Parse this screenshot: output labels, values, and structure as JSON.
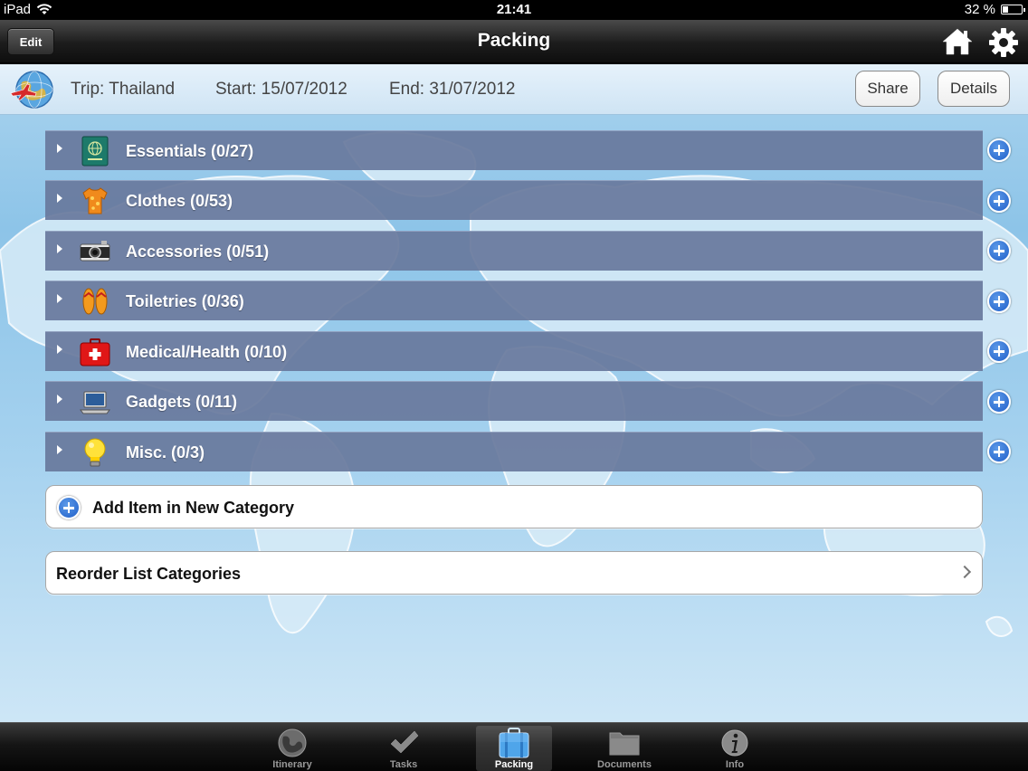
{
  "status_bar": {
    "device": "iPad",
    "time": "21:41",
    "battery": "32 %",
    "battery_level": 0.32
  },
  "nav": {
    "edit_label": "Edit",
    "title": "Packing"
  },
  "trip": {
    "trip_label": "Trip: Thailand",
    "start_label": "Start: 15/07/2012",
    "end_label": "End: 31/07/2012",
    "share_label": "Share",
    "details_label": "Details"
  },
  "categories": [
    {
      "label": "Essentials (0/27)",
      "icon": "passport-icon"
    },
    {
      "label": "Clothes (0/53)",
      "icon": "shirt-icon"
    },
    {
      "label": "Accessories (0/51)",
      "icon": "camera-icon"
    },
    {
      "label": "Toiletries (0/36)",
      "icon": "flip-flops-icon"
    },
    {
      "label": "Medical/Health (0/10)",
      "icon": "first-aid-kit-icon"
    },
    {
      "label": "Gadgets (0/11)",
      "icon": "laptop-icon"
    },
    {
      "label": "Misc. (0/3)",
      "icon": "lightbulb-icon"
    }
  ],
  "actions": {
    "add_new_category": "Add Item in New Category",
    "reorder": "Reorder List Categories"
  },
  "tabs": [
    {
      "label": "Itinerary",
      "icon": "globe-icon",
      "active": false
    },
    {
      "label": "Tasks",
      "icon": "checkmark-icon",
      "active": false
    },
    {
      "label": "Packing",
      "icon": "suitcase-icon",
      "active": true
    },
    {
      "label": "Documents",
      "icon": "folder-icon",
      "active": false
    },
    {
      "label": "Info",
      "icon": "info-icon",
      "active": false
    }
  ]
}
